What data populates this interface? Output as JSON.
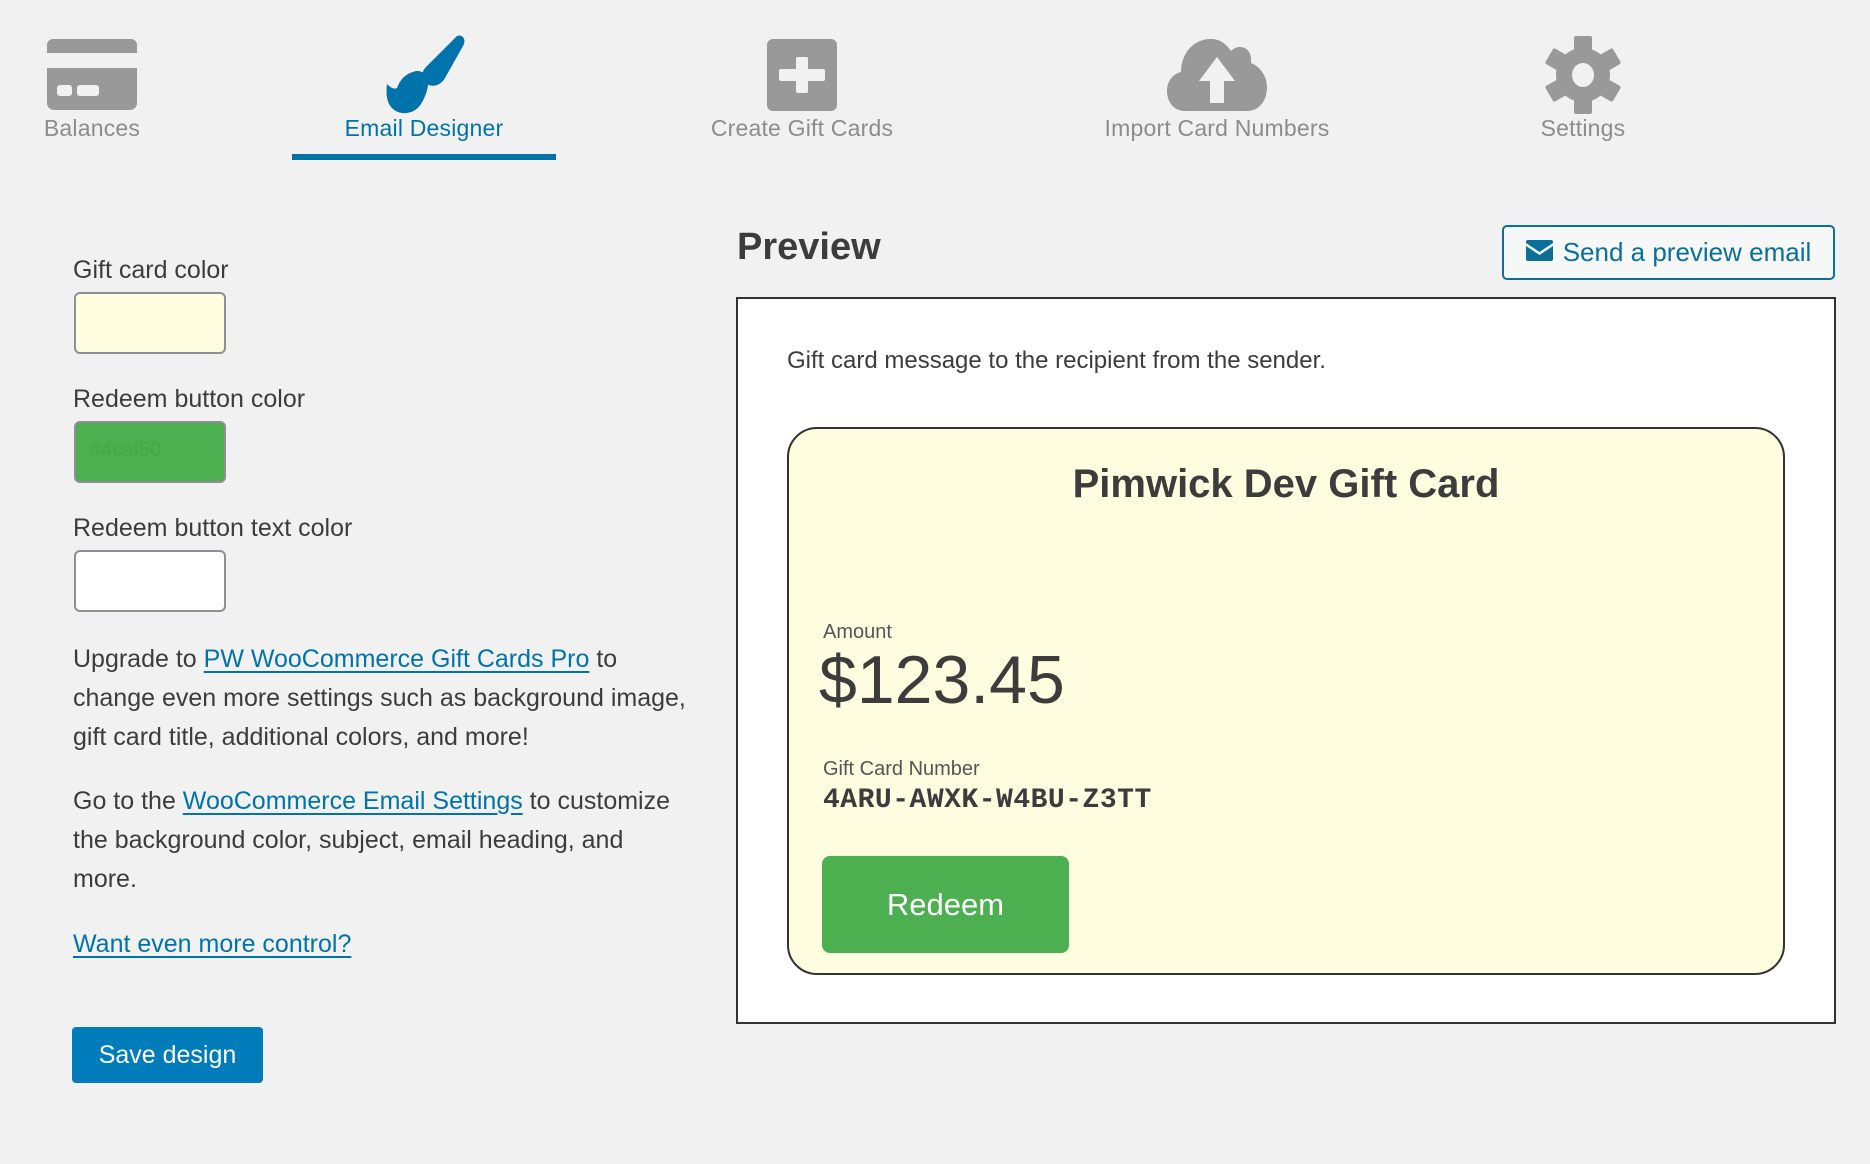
{
  "tabs": [
    {
      "id": "balances",
      "label": "Balances",
      "icon": "credit-card-icon",
      "active": false
    },
    {
      "id": "email-designer",
      "label": "Email Designer",
      "icon": "paintbrush-icon",
      "active": true
    },
    {
      "id": "create-gift-cards",
      "label": "Create Gift Cards",
      "icon": "plus-card-icon",
      "active": false
    },
    {
      "id": "import-card-numbers",
      "label": "Import Card Numbers",
      "icon": "cloud-upload-icon",
      "active": false
    },
    {
      "id": "settings",
      "label": "Settings",
      "icon": "gear-icon",
      "active": false
    }
  ],
  "colors": {
    "active_tab": "#0073aa",
    "inactive_tab": "#8c8c8c",
    "primary_button": "#007cba"
  },
  "designer": {
    "fields": [
      {
        "label": "Gift card color",
        "value": "#fffde0",
        "text_color": "#fffde0"
      },
      {
        "label": "Redeem button color",
        "value": "#4caf50",
        "text_color": "#3e8e41"
      },
      {
        "label": "Redeem button text color",
        "value": "#ffffff",
        "text_color": "#ffffff"
      }
    ],
    "upgrade": {
      "prefix": "Upgrade to ",
      "link": "PW WooCommerce Gift Cards Pro",
      "suffix": " to change even more settings such as background image, gift card title, additional colors, and more!"
    },
    "email_settings": {
      "prefix": "Go to the ",
      "link": "WooCommerce Email Settings",
      "suffix": " to customize the background color, subject, email heading, and more."
    },
    "more_control_link": "Want even more control?",
    "save_label": "Save design"
  },
  "preview": {
    "title": "Preview",
    "send_label": "Send a preview email",
    "send_icon": "envelope-icon",
    "message": "Gift card message to the recipient from the sender.",
    "card": {
      "title": "Pimwick Dev Gift Card",
      "amount_label": "Amount",
      "amount": "$123.45",
      "number_label": "Gift Card Number",
      "number": "4ARU-AWXK-W4BU-Z3TT",
      "redeem_label": "Redeem",
      "background": "#fefde0",
      "button_color": "#4caf50",
      "button_text_color": "#ffffff"
    }
  }
}
